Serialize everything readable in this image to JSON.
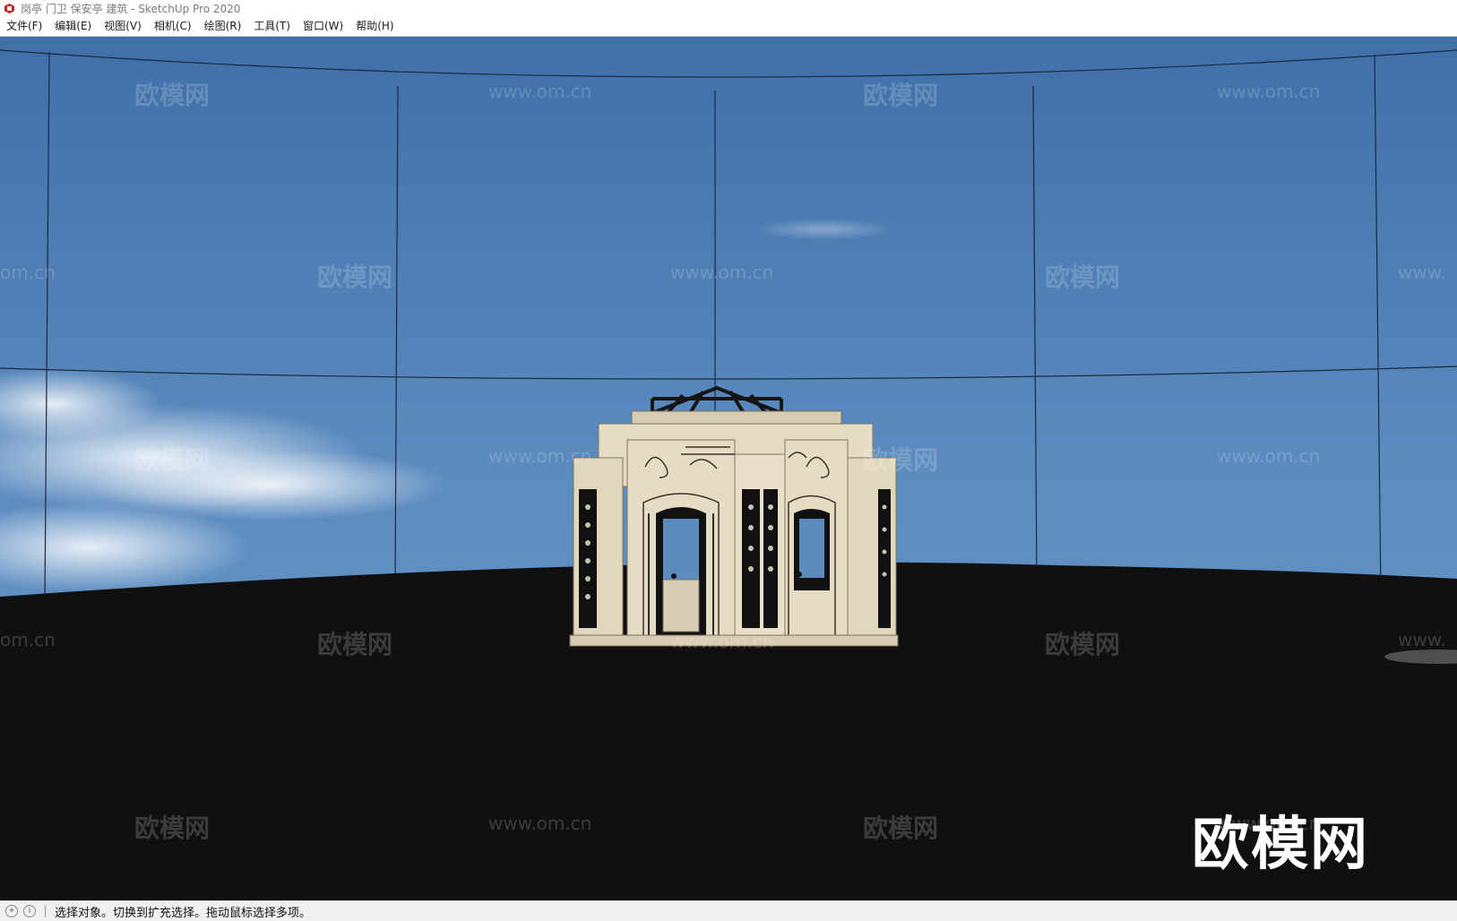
{
  "window": {
    "title": "岗亭 门卫 保安亭 建筑 - SketchUp Pro 2020"
  },
  "menu": {
    "items": [
      "文件(F)",
      "编辑(E)",
      "视图(V)",
      "相机(C)",
      "绘图(R)",
      "工具(T)",
      "窗口(W)",
      "帮助(H)"
    ]
  },
  "viewport": {
    "sky_color": "#5b8bbf",
    "ground_color": "#101010",
    "building_stone_color": "#e6dcc4"
  },
  "watermarks": {
    "brand": "欧模网",
    "url": "www.om.cn",
    "url_partial": "om.cn",
    "url_partial_right": "www."
  },
  "status": {
    "message": "选择对象。切换到扩充选择。拖动鼠标选择多项。",
    "icon_geo": "geo-location-icon",
    "icon_info": "info-icon"
  }
}
